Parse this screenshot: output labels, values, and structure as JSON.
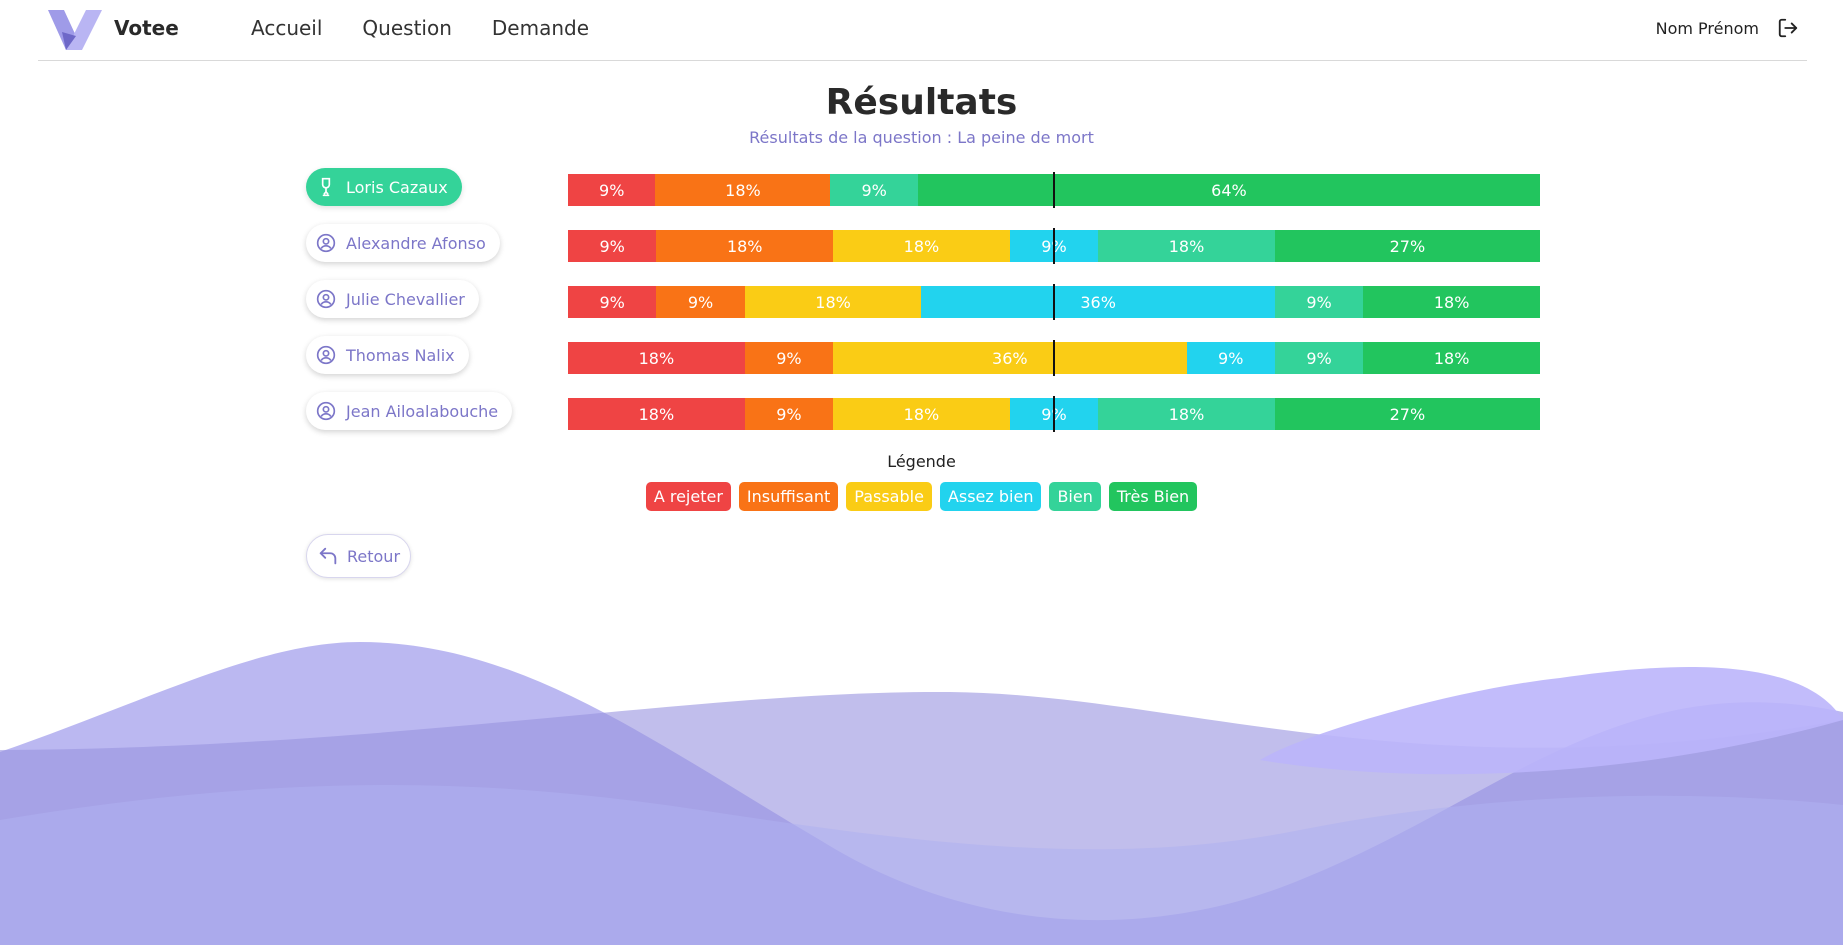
{
  "header": {
    "brand": "Votee",
    "logo_icon": "votee-logo-icon",
    "nav": [
      "Accueil",
      "Question",
      "Demande"
    ],
    "user_name": "Nom Prénom",
    "logout_icon": "logout-icon"
  },
  "page": {
    "title": "Résultats",
    "subtitle": "Résultats de la question : La peine de mort"
  },
  "grades": [
    {
      "label": "A rejeter",
      "color": "#ef4444"
    },
    {
      "label": "Insuffisant",
      "color": "#f97316"
    },
    {
      "label": "Passable",
      "color": "#facc15"
    },
    {
      "label": "Assez bien",
      "color": "#22d3ee"
    },
    {
      "label": "Bien",
      "color": "#34d399"
    },
    {
      "label": "Très Bien",
      "color": "#22c55e"
    }
  ],
  "legend": {
    "title": "Légende"
  },
  "back": {
    "label": "Retour",
    "icon": "reply-arrow-icon"
  },
  "chart_data": {
    "type": "bar",
    "stacked": true,
    "orientation": "horizontal",
    "median_marker": 50,
    "categories": [
      "Loris Cazaux",
      "Alexandre Afonso",
      "Julie Chevallier",
      "Thomas Nalix",
      "Jean Ailoalabouche"
    ],
    "winner": "Loris Cazaux",
    "series": [
      {
        "name": "A rejeter",
        "values": [
          9,
          9,
          9,
          18,
          18
        ]
      },
      {
        "name": "Insuffisant",
        "values": [
          18,
          18,
          9,
          9,
          9
        ]
      },
      {
        "name": "Passable",
        "values": [
          0,
          18,
          18,
          36,
          18
        ]
      },
      {
        "name": "Assez bien",
        "values": [
          0,
          9,
          36,
          9,
          9
        ]
      },
      {
        "name": "Bien",
        "values": [
          9,
          18,
          9,
          9,
          18
        ]
      },
      {
        "name": "Très Bien",
        "values": [
          64,
          27,
          18,
          18,
          27
        ]
      }
    ]
  }
}
